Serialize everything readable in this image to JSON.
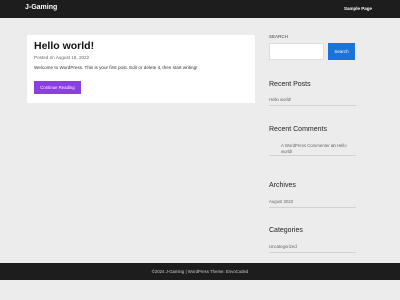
{
  "header": {
    "site_title": "J-Gaming",
    "nav_link": "Sample Page"
  },
  "post": {
    "title": "Hello world!",
    "meta": "Posted on August 18, 2022",
    "excerpt": "Welcome to WordPress. This is your first post. Edit or delete it, then start writing!",
    "button_label": "Continue Reading"
  },
  "sidebar": {
    "search": {
      "label": "SEARCH",
      "placeholder": "",
      "button_label": "Search"
    },
    "recent_posts": {
      "title": "Recent Posts",
      "items": [
        "Hello world!"
      ]
    },
    "recent_comments": {
      "title": "Recent Comments",
      "author": "A WordPress Commenter",
      "connector": "on",
      "post": "Hello world!"
    },
    "archives": {
      "title": "Archives",
      "items": [
        "August 2022"
      ]
    },
    "categories": {
      "title": "Categories",
      "items": [
        "Uncategorized"
      ]
    }
  },
  "footer": {
    "text": "©2024 J-Gaming | WordPress Theme: EnvoCoded"
  },
  "colors": {
    "header_bg": "#1d1d1d",
    "page_bg": "#ececec",
    "accent_purple": "#8a3fe0",
    "accent_blue": "#1a73d9"
  }
}
